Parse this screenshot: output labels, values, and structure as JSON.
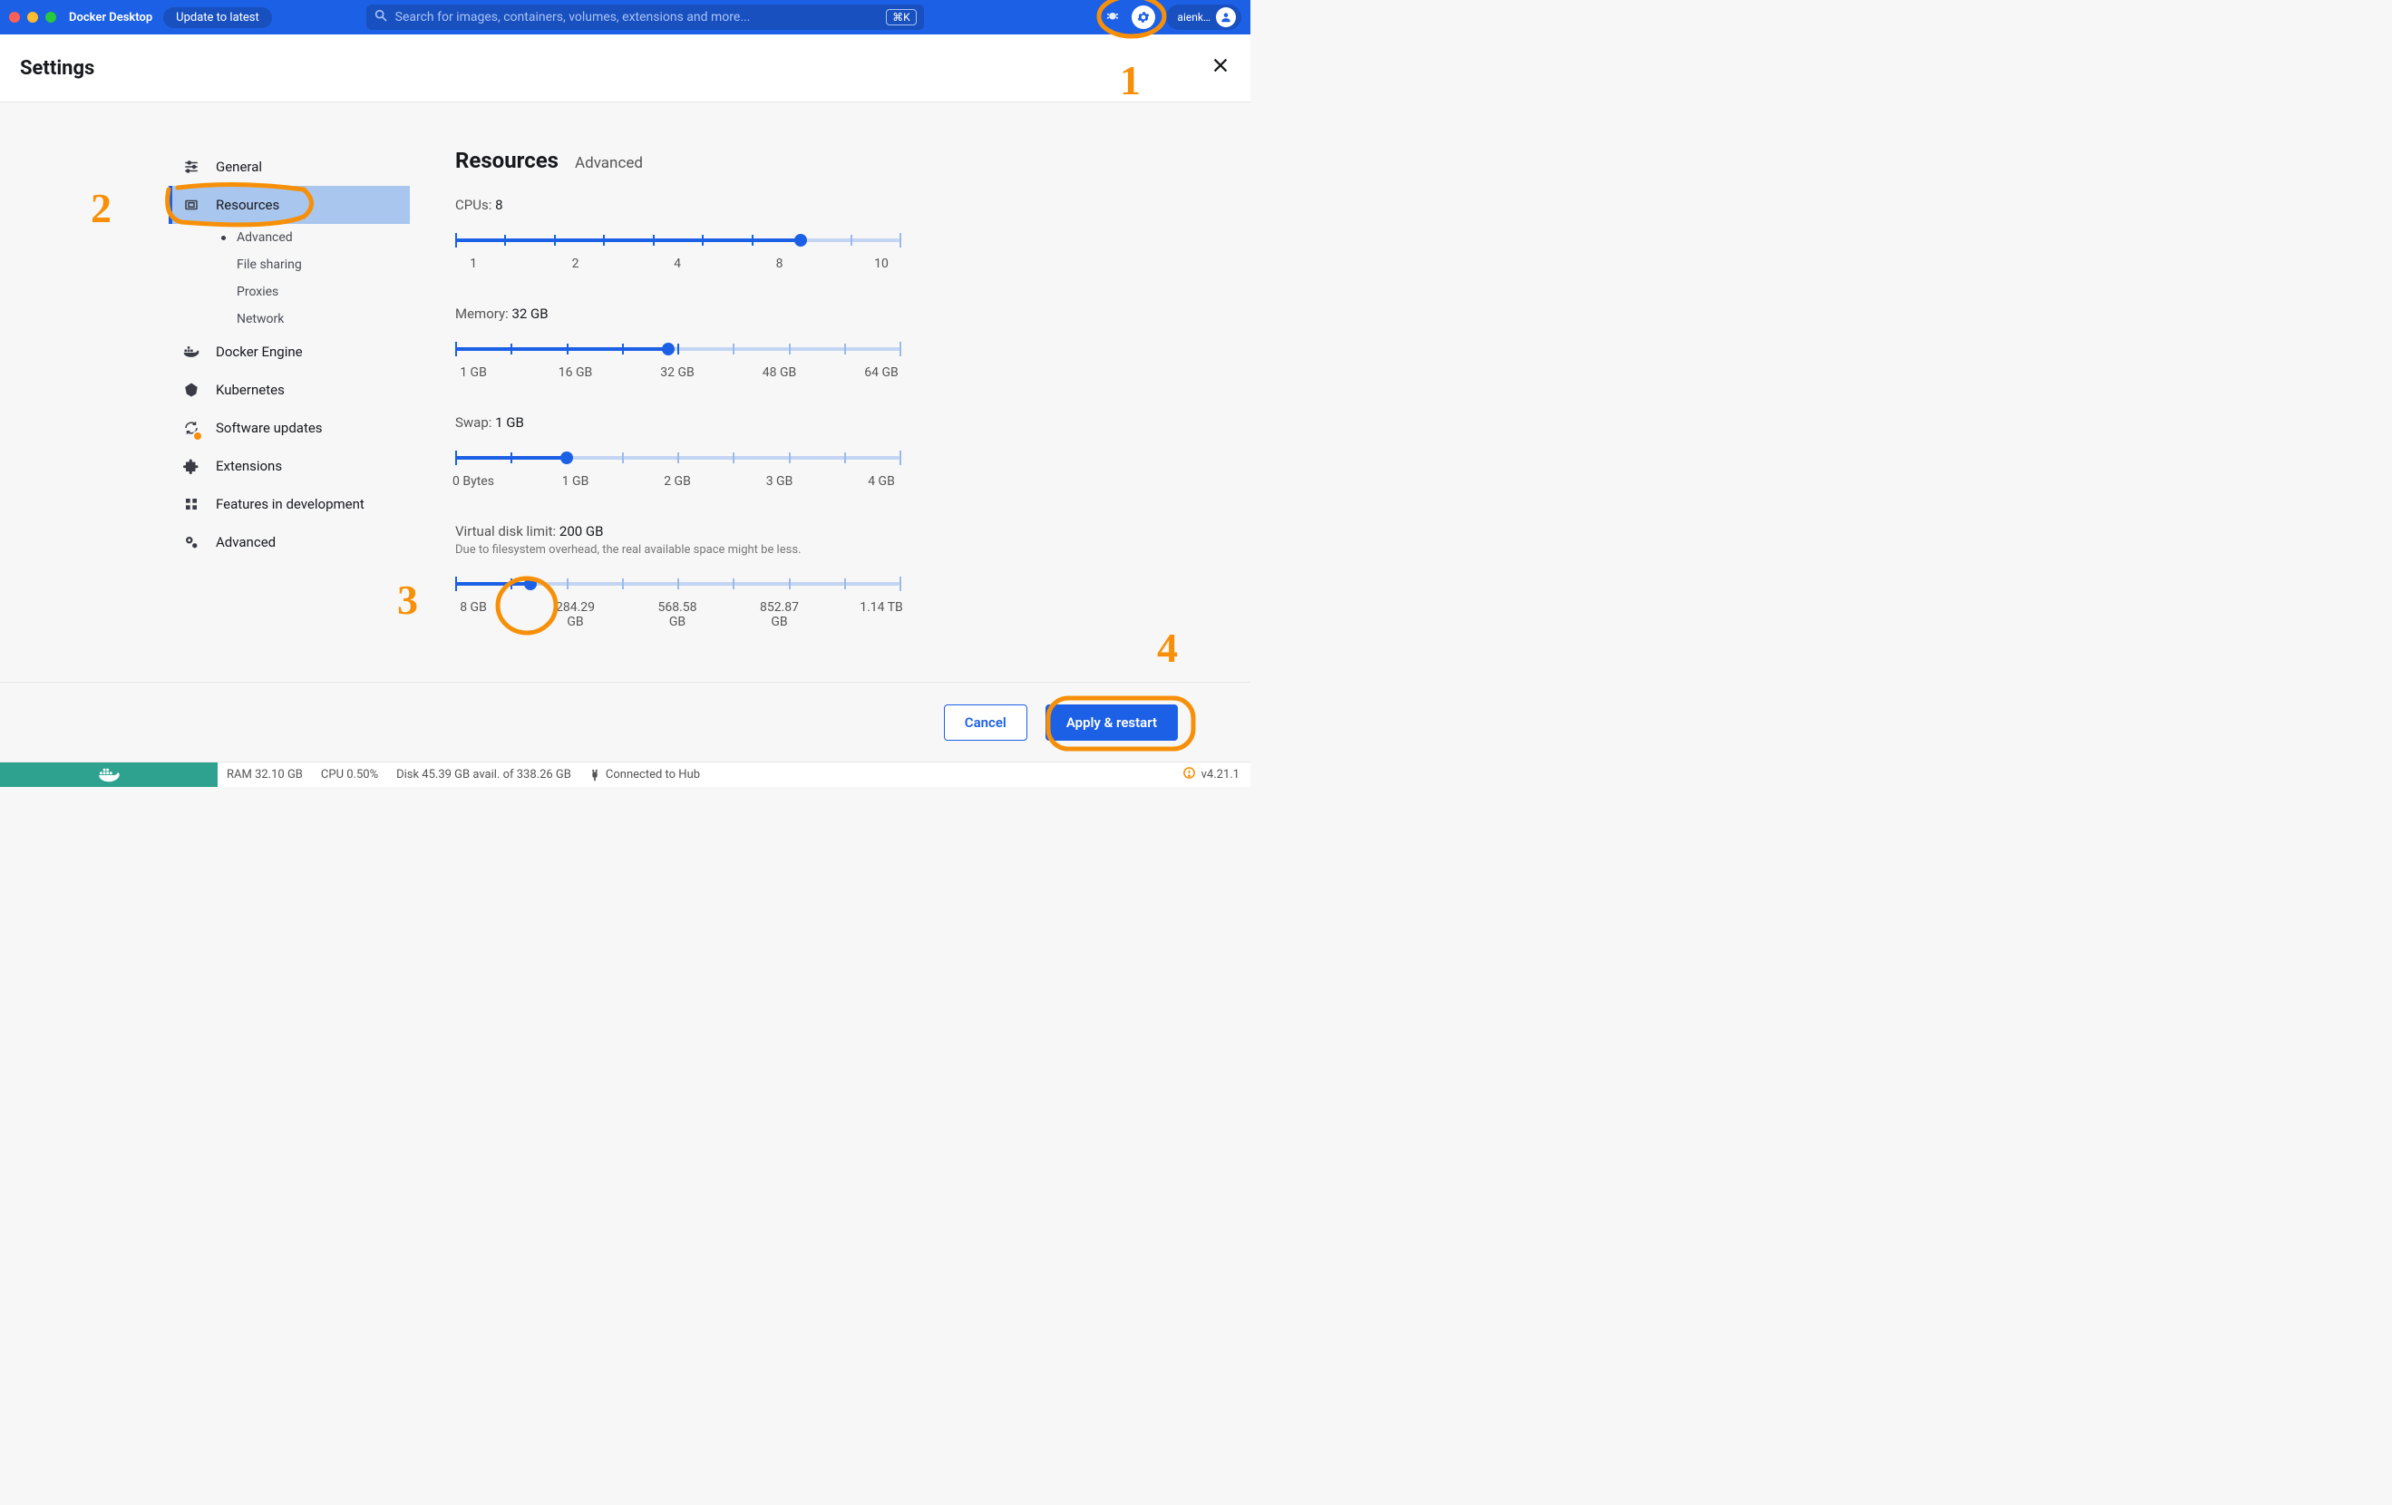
{
  "topbar": {
    "app_name": "Docker Desktop",
    "update_label": "Update to latest",
    "search_placeholder": "Search for images, containers, volumes, extensions and more...",
    "shortcut": "⌘K",
    "username": "aienk…"
  },
  "header": {
    "title": "Settings"
  },
  "sidebar": {
    "items": [
      {
        "label": "General"
      },
      {
        "label": "Resources"
      },
      {
        "label": "Docker Engine"
      },
      {
        "label": "Kubernetes"
      },
      {
        "label": "Software updates"
      },
      {
        "label": "Extensions"
      },
      {
        "label": "Features in development"
      },
      {
        "label": "Advanced"
      }
    ],
    "resources_sub": [
      {
        "label": "Advanced"
      },
      {
        "label": "File sharing"
      },
      {
        "label": "Proxies"
      },
      {
        "label": "Network"
      }
    ]
  },
  "content": {
    "title": "Resources",
    "subtitle": "Advanced",
    "cpus": {
      "label": "CPUs:",
      "value": "8",
      "ticks": [
        "1",
        "2",
        "4",
        "8",
        "10"
      ],
      "fill_pct": 77.7,
      "n_ticks": 10,
      "thumb_idx": 7
    },
    "memory": {
      "label": "Memory:",
      "value": "32 GB",
      "ticks": [
        "1 GB",
        "16 GB",
        "32 GB",
        "48 GB",
        "64 GB"
      ],
      "fill_pct": 48,
      "n_ticks": 9,
      "thumb_idx": 4
    },
    "swap": {
      "label": "Swap:",
      "value": "1 GB",
      "ticks": [
        "0 Bytes",
        "1 GB",
        "2 GB",
        "3 GB",
        "4 GB"
      ],
      "fill_pct": 25,
      "n_ticks": 9,
      "thumb_idx": 2
    },
    "disk": {
      "label": "Virtual disk limit:",
      "value": "200 GB",
      "note": "Due to filesystem overhead, the real available space might be less.",
      "ticks": [
        "8 GB",
        "284.29 GB",
        "568.58 GB",
        "852.87 GB",
        "1.14 TB"
      ],
      "fill_pct": 17,
      "n_ticks": 9,
      "thumb_idx_frac": 1.35
    }
  },
  "footer": {
    "cancel": "Cancel",
    "apply": "Apply & restart"
  },
  "statusbar": {
    "ram": "RAM 32.10 GB",
    "cpu": "CPU 0.50%",
    "disk": "Disk 45.39 GB avail. of 338.26 GB",
    "hub": "Connected to Hub",
    "version": "v4.21.1"
  },
  "annotations": {
    "n1": "1",
    "n2": "2",
    "n3": "3",
    "n4": "4"
  }
}
